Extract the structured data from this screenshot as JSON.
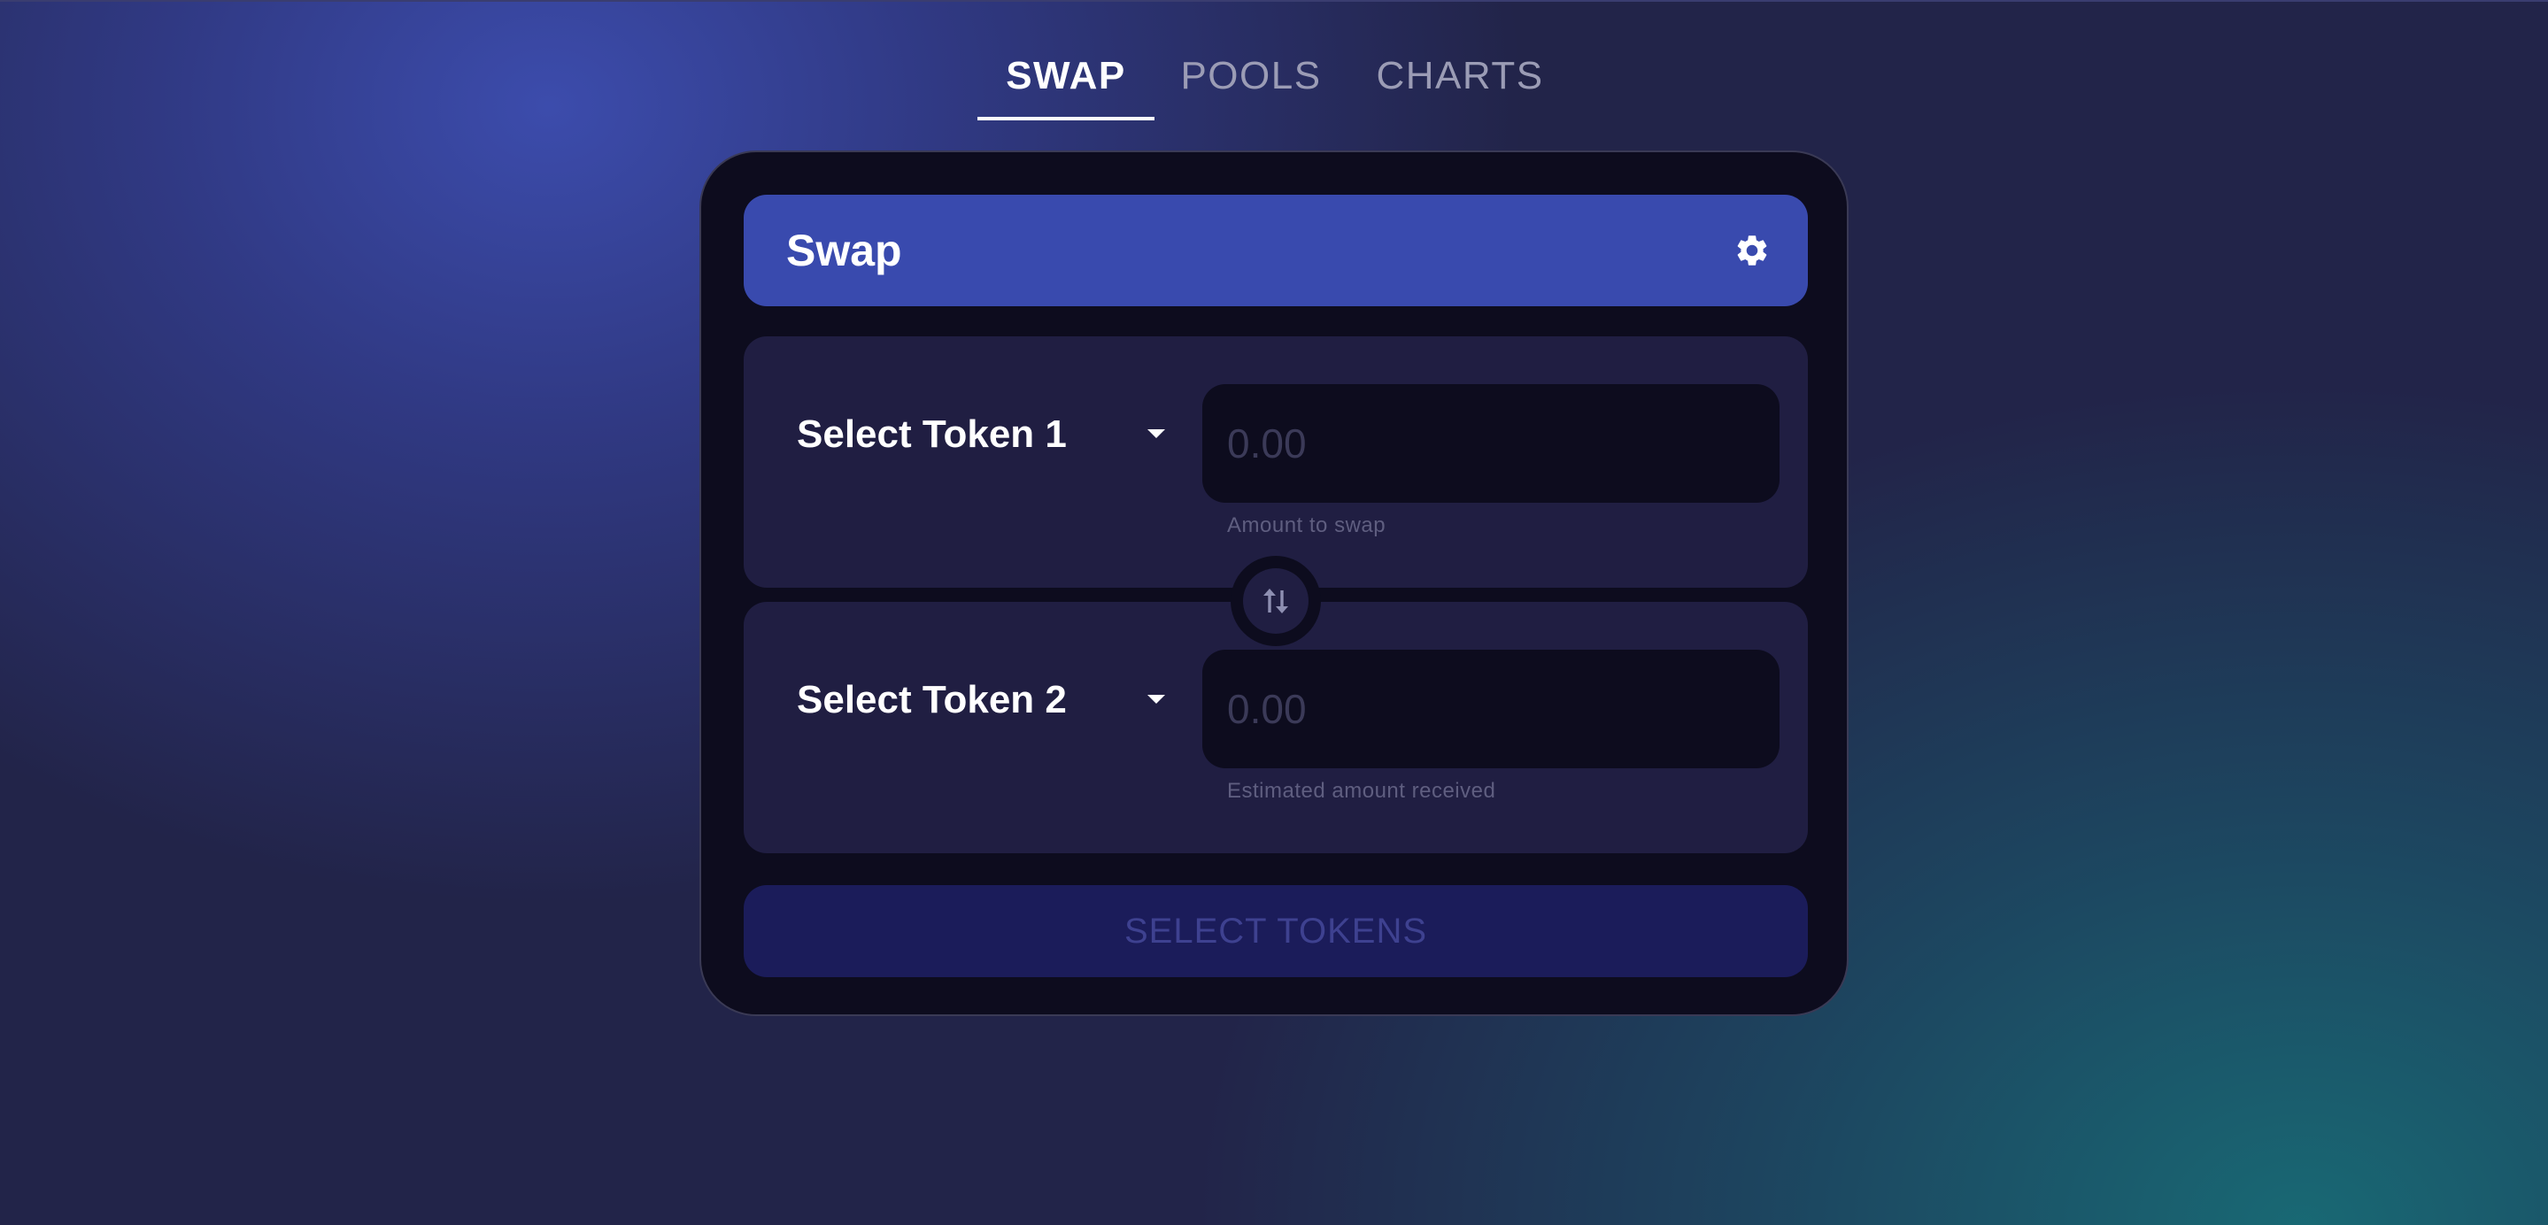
{
  "nav": {
    "tabs": [
      {
        "label": "SWAP",
        "active": true
      },
      {
        "label": "POOLS",
        "active": false
      },
      {
        "label": "CHARTS",
        "active": false
      }
    ]
  },
  "card": {
    "title": "Swap",
    "settings_icon": "gear-icon",
    "from": {
      "token_label": "Select Token 1",
      "amount_placeholder": "0.00",
      "amount_value": "",
      "helper_text": "Amount to swap"
    },
    "swap_direction_icon": "swap-vertical-arrows-icon",
    "to": {
      "token_label": "Select Token 2",
      "amount_placeholder": "0.00",
      "amount_value": "",
      "helper_text": "Estimated amount received"
    },
    "action_button_label": "SELECT TOKENS",
    "action_button_disabled": true
  },
  "colors": {
    "accent": "#394aae",
    "card_background": "#0d0c1e",
    "panel_background": "#201e42",
    "disabled_button": "#1b1c5a"
  }
}
